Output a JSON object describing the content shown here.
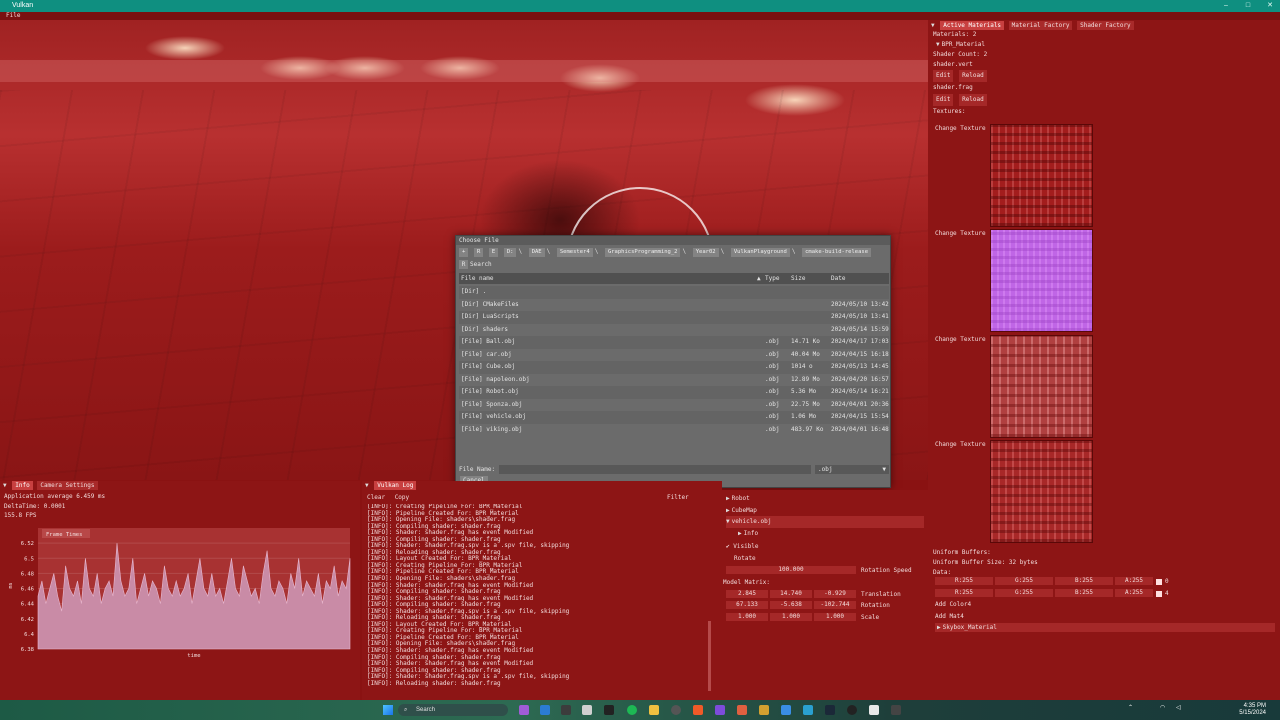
{
  "window": {
    "title": "Vulkan",
    "minimize": "–",
    "maximize": "□",
    "close": "✕"
  },
  "menu": {
    "file": "File"
  },
  "right_panel": {
    "tabs": [
      "Active Materials",
      "Material Factory",
      "Shader Factory"
    ],
    "materials_count": "Materials: 2",
    "material_name": "BPR_Material",
    "shader_count": "Shader Count: 2",
    "shaders": [
      {
        "name": "shader.vert",
        "edit": "Edit",
        "reload": "Reload"
      },
      {
        "name": "shader.frag",
        "edit": "Edit",
        "reload": "Reload"
      }
    ],
    "textures_label": "Textures:",
    "change_texture": "Change Texture",
    "uniform_buffers": "Uniform Buffers:",
    "uniform_size": "Uniform Buffer Size: 32 bytes",
    "data_label": "Data:",
    "color_rows": [
      {
        "r": "R:255",
        "g": "G:255",
        "b": "B:255",
        "a": "A:255",
        "idx": "0"
      },
      {
        "r": "R:255",
        "g": "G:255",
        "b": "B:255",
        "a": "A:255",
        "idx": "4"
      }
    ],
    "add_color": "Add Color4",
    "add_mat4": "Add Mat4",
    "skybox_material": "Skybox_Material"
  },
  "file_dialog": {
    "title": "Choose File",
    "nav_buttons": [
      "+",
      "R",
      "E"
    ],
    "path": [
      "D:",
      "DAE",
      "Semester4",
      "GraphicsProgramming_2",
      "Year02",
      "VulkanPlayground",
      "cmake-build-release"
    ],
    "search_label": "Search",
    "columns": {
      "name": "File name",
      "type": "Type",
      "size": "Size",
      "date": "Date"
    },
    "files": [
      {
        "name": "[Dir] .",
        "type": "",
        "size": "",
        "date": ""
      },
      {
        "name": "[Dir] CMakeFiles",
        "type": "",
        "size": "",
        "date": "2024/05/10 13:42"
      },
      {
        "name": "[Dir] LuaScripts",
        "type": "",
        "size": "",
        "date": "2024/05/10 13:41"
      },
      {
        "name": "[Dir] shaders",
        "type": "",
        "size": "",
        "date": "2024/05/14 15:59"
      },
      {
        "name": "[File] Ball.obj",
        "type": ".obj",
        "size": "14.71 Ko",
        "date": "2024/04/17 17:03"
      },
      {
        "name": "[File] car.obj",
        "type": ".obj",
        "size": "40.04 Mo",
        "date": "2024/04/15 16:18"
      },
      {
        "name": "[File] Cube.obj",
        "type": ".obj",
        "size": "1014 o",
        "date": "2024/05/13 14:45"
      },
      {
        "name": "[File] napoleon.obj",
        "type": ".obj",
        "size": "12.89 Mo",
        "date": "2024/04/20 16:57"
      },
      {
        "name": "[File] Robot.obj",
        "type": ".obj",
        "size": "5.36 Mo",
        "date": "2024/05/14 16:21"
      },
      {
        "name": "[File] Sponza.obj",
        "type": ".obj",
        "size": "22.75 Mo",
        "date": "2024/04/01 20:36"
      },
      {
        "name": "[File] vehicle.obj",
        "type": ".obj",
        "size": "1.06 Mo",
        "date": "2024/04/15 15:54"
      },
      {
        "name": "[File] viking.obj",
        "type": ".obj",
        "size": "483.97 Ko",
        "date": "2024/04/01 16:48"
      }
    ],
    "file_name_label": "File Name:",
    "filter": ".obj",
    "cancel": "Cancel"
  },
  "info_panel": {
    "tabs": [
      "Info",
      "Camera Settings"
    ],
    "app_average": "Application average 6.459 ms",
    "delta_time": "DeltaTime: 0.0001",
    "fps": "155.8 FPS",
    "legend": "Frame Times",
    "xlabel": "time",
    "ylabel": "ms"
  },
  "chart_data": {
    "type": "area",
    "title": "",
    "xlabel": "time",
    "ylabel": "ms",
    "ylim": [
      6.38,
      6.54
    ],
    "yticks": [
      6.52,
      6.5,
      6.48,
      6.46,
      6.44,
      6.42,
      6.4,
      6.38
    ],
    "series": [
      {
        "name": "Frame Times",
        "values": [
          6.45,
          6.47,
          6.44,
          6.46,
          6.48,
          6.45,
          6.43,
          6.49,
          6.46,
          6.45,
          6.47,
          6.44,
          6.5,
          6.46,
          6.45,
          6.48,
          6.44,
          6.46,
          6.47,
          6.45,
          6.52,
          6.47,
          6.45,
          6.46,
          6.5,
          6.44,
          6.46,
          6.48,
          6.45,
          6.47,
          6.46,
          6.44,
          6.49,
          6.46,
          6.45,
          6.47,
          6.45,
          6.46,
          6.48,
          6.44,
          6.47,
          6.5,
          6.46,
          6.45,
          6.48,
          6.45,
          6.46,
          6.44,
          6.47,
          6.5,
          6.46,
          6.45,
          6.49,
          6.47,
          6.45,
          6.46,
          6.44,
          6.48,
          6.51,
          6.46,
          6.45,
          6.47,
          6.46,
          6.44,
          6.48,
          6.46,
          6.5,
          6.45,
          6.47,
          6.46,
          6.45,
          6.48,
          6.44,
          6.47,
          6.46,
          6.49,
          6.45,
          6.47,
          6.46,
          6.5
        ]
      }
    ]
  },
  "log_panel": {
    "title": "Vulkan Log",
    "clear": "Clear",
    "copy": "Copy",
    "filter": "Filter",
    "lines": [
      "[INFO]: Creating Pipeline For: BPR_Material",
      "[INFO]: Pipeline Created For: BPR_Material",
      "[INFO]: Opening File: shaders\\shader.frag",
      "[INFO]: Compiling shader: shader.frag",
      "[INFO]: Shader: shader.frag has event Modified",
      "[INFO]: Compiling shader: shader.frag",
      "[INFO]: Shader: shader.frag.spv is a .spv file, skipping",
      "[INFO]: Reloading shader: shader.frag",
      "[INFO]: Layout Created For: BPR_Material",
      "[INFO]: Creating Pipeline For: BPR_Material",
      "[INFO]: Pipeline Created For: BPR_Material",
      "[INFO]: Opening File: shaders\\shader.frag",
      "[INFO]: Shader: shader.frag has event Modified",
      "[INFO]: Compiling shader: shader.frag",
      "[INFO]: Shader: shader.frag has event Modified",
      "[INFO]: Compiling shader: shader.frag",
      "[INFO]: Shader: shader.frag.spv is a .spv file, skipping",
      "[INFO]: Reloading shader: shader.frag",
      "[INFO]: Layout Created For: BPR_Material",
      "[INFO]: Creating Pipeline For: BPR_Material",
      "[INFO]: Pipeline Created For: BPR_Material",
      "[INFO]: Opening File: shaders\\shader.frag",
      "[INFO]: Shader: shader.frag has event Modified",
      "[INFO]: Compiling shader: shader.frag",
      "[INFO]: Shader: shader.frag has event Modified",
      "[INFO]: Compiling shader: shader.frag",
      "[INFO]: Shader: shader.frag.spv is a .spv file, skipping",
      "[INFO]: Reloading shader: shader.frag"
    ]
  },
  "scene_panel": {
    "objects": [
      "Robot",
      "CubeMap",
      "vehicle.obj"
    ],
    "info": "Info",
    "visible": "Visible",
    "rotate": "Rotate",
    "rotation_speed": {
      "value": "100.000",
      "label": "Rotation Speed"
    },
    "model_matrix": "Model Matrix:",
    "translation": {
      "values": [
        "2.845",
        "14.740",
        "-0.929"
      ],
      "label": "Translation"
    },
    "rotation": {
      "values": [
        "67.133",
        "-5.638",
        "-102.744"
      ],
      "label": "Rotation"
    },
    "scale": {
      "values": [
        "1.000",
        "1.000",
        "1.000"
      ],
      "label": "Scale"
    }
  },
  "taskbar": {
    "search": "Search",
    "time": "4:35 PM",
    "date": "5/15/2024"
  }
}
